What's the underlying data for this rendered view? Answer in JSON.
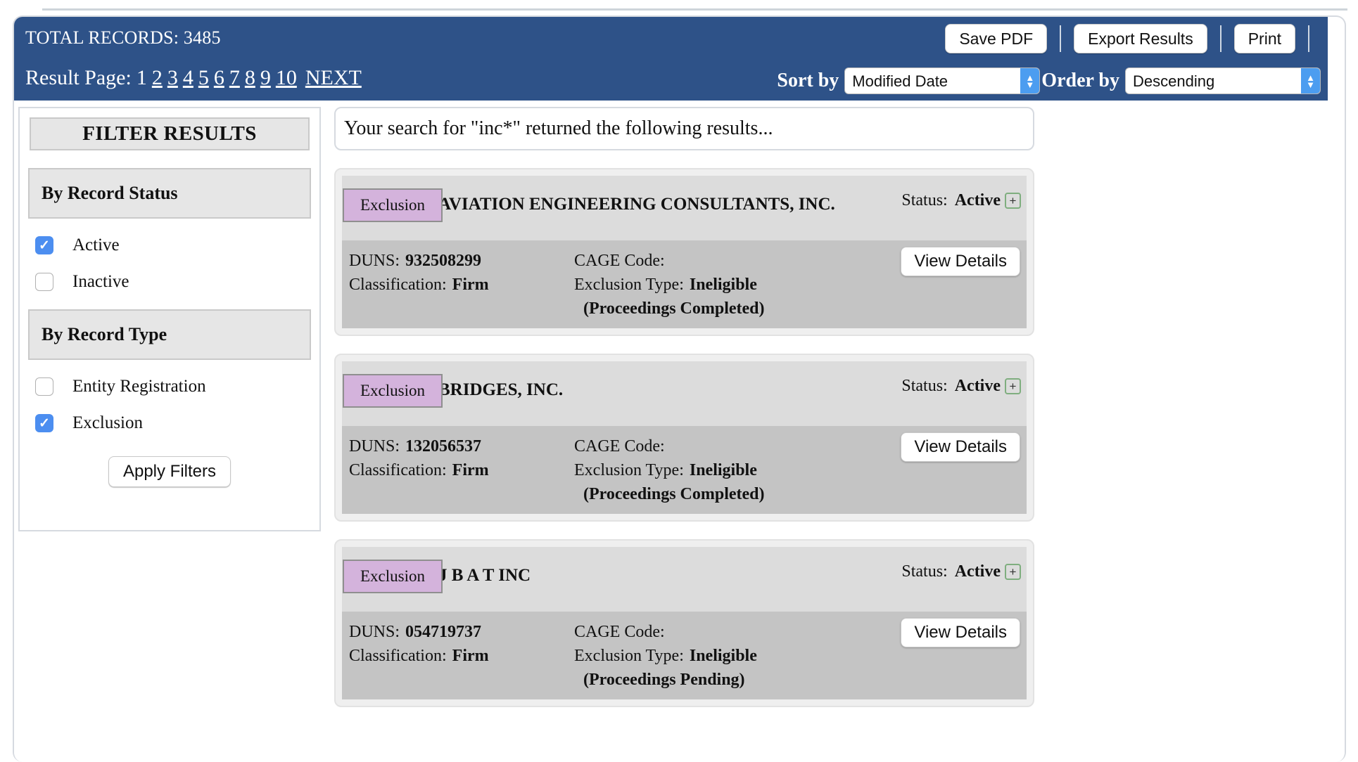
{
  "header": {
    "total_records_label": "TOTAL RECORDS:",
    "total_records_value": "3485",
    "buttons": {
      "save_pdf": "Save PDF",
      "export_results": "Export Results",
      "print": "Print"
    },
    "pagination": {
      "label": "Result Page:",
      "current": "1",
      "pages": [
        "2",
        "3",
        "4",
        "5",
        "6",
        "7",
        "8",
        "9",
        "10"
      ],
      "next": "NEXT"
    },
    "sort": {
      "sort_by_label": "Sort by",
      "sort_by_value": "Modified Date",
      "order_by_label": "Order by",
      "order_by_value": "Descending"
    },
    "accent_color": "#2e5288"
  },
  "sidebar": {
    "title": "FILTER RESULTS",
    "groups": [
      {
        "heading": "By Record Status",
        "options": [
          {
            "label": "Active",
            "checked": true
          },
          {
            "label": "Inactive",
            "checked": false
          }
        ]
      },
      {
        "heading": "By Record Type",
        "options": [
          {
            "label": "Entity Registration",
            "checked": false
          },
          {
            "label": "Exclusion",
            "checked": true
          }
        ]
      }
    ],
    "apply_label": "Apply Filters",
    "checkbox_color": "#4c8ef0"
  },
  "results": {
    "banner": "Your search for \"inc*\" returned the following results...",
    "labels": {
      "status": "Status:",
      "duns": "DUNS:",
      "cage": "CAGE Code:",
      "classification": "Classification:",
      "exclusion_type": "Exclusion Type:",
      "view_details": "View Details",
      "expand_icon": "+"
    },
    "badge_color": "#d4b3dc",
    "items": [
      {
        "badge": "Exclusion",
        "name": "AVIATION ENGINEERING CONSULTANTS, INC.",
        "status": "Active",
        "duns": "932508299",
        "cage": "",
        "classification": "Firm",
        "exclusion_type": "Ineligible",
        "proceedings": "(Proceedings Completed)"
      },
      {
        "badge": "Exclusion",
        "name": "BRIDGES, INC.",
        "status": "Active",
        "duns": "132056537",
        "cage": "",
        "classification": "Firm",
        "exclusion_type": "Ineligible",
        "proceedings": "(Proceedings Completed)"
      },
      {
        "badge": "Exclusion",
        "name": "J B A T INC",
        "status": "Active",
        "duns": "054719737",
        "cage": "",
        "classification": "Firm",
        "exclusion_type": "Ineligible",
        "proceedings": "(Proceedings Pending)"
      }
    ]
  }
}
